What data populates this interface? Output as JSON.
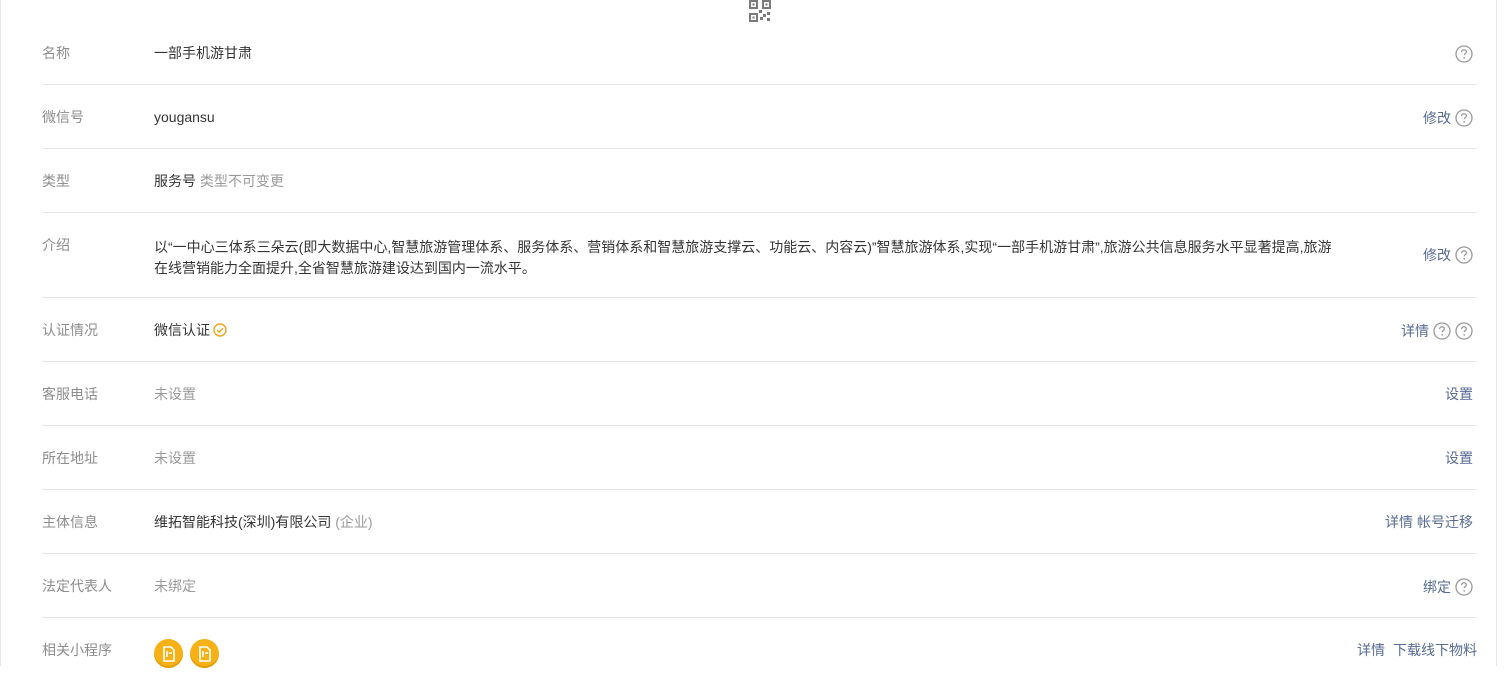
{
  "rows": [
    {
      "label": "名称",
      "value": "一部手机游甘肃",
      "actions": []
    },
    {
      "label": "微信号",
      "value": "yougansu",
      "actions": [
        "修改"
      ]
    },
    {
      "label": "类型",
      "value": "服务号",
      "note": "类型不可变更",
      "actions": []
    },
    {
      "label": "介绍",
      "value": "以“一中心三体系三朵云(即大数据中心,智慧旅游管理体系、服务体系、营销体系和智慧旅游支撑云、功能云、内容云)”智慧旅游体系,实现“一部手机游甘肃”,旅游公共信息服务水平显著提高,旅游在线营销能力全面提升,全省智慧旅游建设达到国内一流水平。",
      "actions": [
        "修改"
      ]
    },
    {
      "label": "认证情况",
      "value": "微信认证",
      "actions": [
        "详情"
      ]
    },
    {
      "label": "客服电话",
      "value": "未设置",
      "actions": [
        "设置"
      ]
    },
    {
      "label": "所在地址",
      "value": "未设置",
      "actions": [
        "设置"
      ]
    },
    {
      "label": "主体信息",
      "value": "维拓智能科技(深圳)有限公司",
      "note": "(企业)",
      "actions": [
        "详情",
        "帐号迁移"
      ]
    },
    {
      "label": "法定代表人",
      "value": "未绑定",
      "actions": [
        "绑定"
      ]
    },
    {
      "label": "相关小程序",
      "value": "",
      "actions": [
        "详情",
        "下载线下物料"
      ]
    }
  ],
  "icons": {
    "qr": "qr-code-icon",
    "help": "question-circle-icon",
    "verified": "verified-check-icon",
    "mini_program": "mini-program-icon"
  },
  "colors": {
    "link": "#576b95",
    "label": "#8d8d8d",
    "divider": "#e7e7eb",
    "verified": "#f3a31d",
    "mini_program": "#f5b116"
  }
}
